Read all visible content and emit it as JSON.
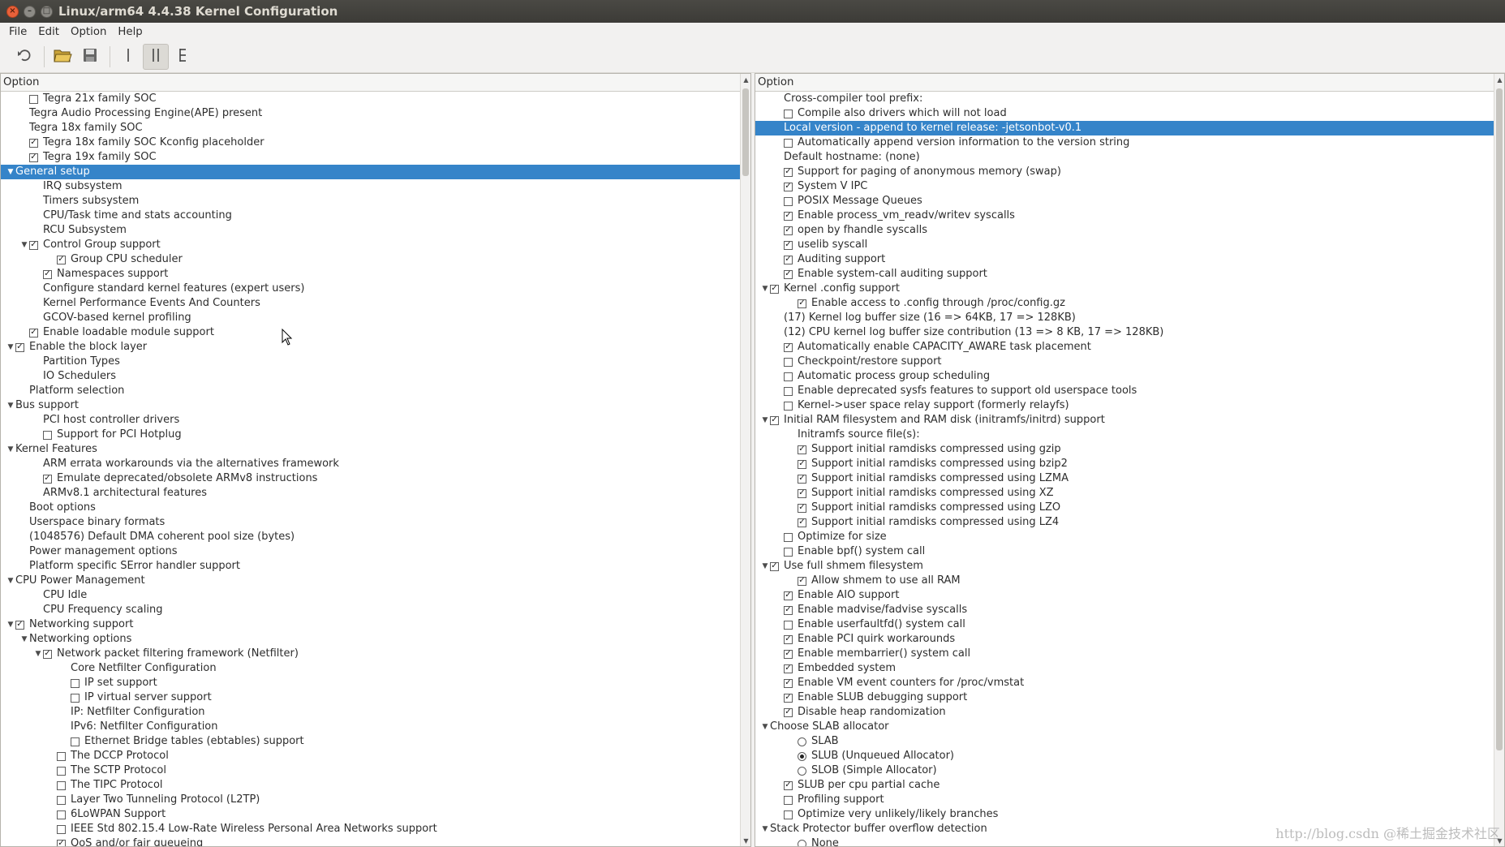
{
  "window": {
    "title": "Linux/arm64 4.4.38 Kernel Configuration"
  },
  "menubar": {
    "items": [
      {
        "label": "File"
      },
      {
        "label": "Edit"
      },
      {
        "label": "Option"
      },
      {
        "label": "Help"
      }
    ]
  },
  "toolbar": {
    "icons": [
      "undo-icon",
      "open-folder-icon",
      "save-icon",
      "single-view-icon",
      "split-view-icon",
      "full-tree-view-icon"
    ]
  },
  "left_panel": {
    "header": "Option",
    "rows": [
      {
        "indent": 1,
        "expander": "",
        "check": "off",
        "label": "Tegra 21x family SOC"
      },
      {
        "indent": 1,
        "expander": "",
        "check": "none",
        "label": "Tegra Audio Processing Engine(APE) present"
      },
      {
        "indent": 1,
        "expander": "",
        "check": "none",
        "label": "Tegra 18x family SOC"
      },
      {
        "indent": 1,
        "expander": "",
        "check": "on",
        "label": "Tegra 18x family SOC Kconfig placeholder"
      },
      {
        "indent": 1,
        "expander": "",
        "check": "on",
        "label": "Tegra 19x family SOC"
      },
      {
        "indent": 0,
        "expander": "open",
        "check": "none",
        "label": "General setup",
        "selected": true
      },
      {
        "indent": 2,
        "expander": "",
        "check": "none",
        "label": "IRQ subsystem"
      },
      {
        "indent": 2,
        "expander": "",
        "check": "none",
        "label": "Timers subsystem"
      },
      {
        "indent": 2,
        "expander": "",
        "check": "none",
        "label": "CPU/Task time and stats accounting"
      },
      {
        "indent": 2,
        "expander": "",
        "check": "none",
        "label": "RCU Subsystem"
      },
      {
        "indent": 1,
        "expander": "open",
        "check": "on",
        "label": "Control Group support"
      },
      {
        "indent": 3,
        "expander": "",
        "check": "on",
        "label": "Group CPU scheduler"
      },
      {
        "indent": 2,
        "expander": "",
        "check": "on",
        "label": "Namespaces support"
      },
      {
        "indent": 2,
        "expander": "",
        "check": "none",
        "label": "Configure standard kernel features (expert users)"
      },
      {
        "indent": 2,
        "expander": "",
        "check": "none",
        "label": "Kernel Performance Events And Counters"
      },
      {
        "indent": 2,
        "expander": "",
        "check": "none",
        "label": "GCOV-based kernel profiling"
      },
      {
        "indent": 1,
        "expander": "",
        "check": "on",
        "label": "Enable loadable module support"
      },
      {
        "indent": 0,
        "expander": "open",
        "check": "on",
        "label": "Enable the block layer"
      },
      {
        "indent": 2,
        "expander": "",
        "check": "none",
        "label": "Partition Types"
      },
      {
        "indent": 2,
        "expander": "",
        "check": "none",
        "label": "IO Schedulers"
      },
      {
        "indent": 1,
        "expander": "",
        "check": "none",
        "label": "Platform selection"
      },
      {
        "indent": 0,
        "expander": "open",
        "check": "none",
        "label": "Bus support"
      },
      {
        "indent": 2,
        "expander": "",
        "check": "none",
        "label": "PCI host controller drivers"
      },
      {
        "indent": 2,
        "expander": "",
        "check": "off",
        "label": "Support for PCI Hotplug"
      },
      {
        "indent": 0,
        "expander": "open",
        "check": "none",
        "label": "Kernel Features"
      },
      {
        "indent": 2,
        "expander": "",
        "check": "none",
        "label": "ARM errata workarounds via the alternatives framework"
      },
      {
        "indent": 2,
        "expander": "",
        "check": "on",
        "label": "Emulate deprecated/obsolete ARMv8 instructions"
      },
      {
        "indent": 2,
        "expander": "",
        "check": "none",
        "label": "ARMv8.1 architectural features"
      },
      {
        "indent": 1,
        "expander": "",
        "check": "none",
        "label": "Boot options"
      },
      {
        "indent": 1,
        "expander": "",
        "check": "none",
        "label": "Userspace binary formats"
      },
      {
        "indent": 1,
        "expander": "",
        "check": "none",
        "label": "(1048576) Default  DMA coherent pool size (bytes)"
      },
      {
        "indent": 1,
        "expander": "",
        "check": "none",
        "label": "Power management options"
      },
      {
        "indent": 1,
        "expander": "",
        "check": "none",
        "label": "Platform specific SError handler support"
      },
      {
        "indent": 0,
        "expander": "open",
        "check": "none",
        "label": "CPU Power Management"
      },
      {
        "indent": 2,
        "expander": "",
        "check": "none",
        "label": "CPU Idle"
      },
      {
        "indent": 2,
        "expander": "",
        "check": "none",
        "label": "CPU Frequency scaling"
      },
      {
        "indent": 0,
        "expander": "open",
        "check": "on",
        "label": "Networking support"
      },
      {
        "indent": 1,
        "expander": "open",
        "check": "none",
        "label": "Networking options"
      },
      {
        "indent": 2,
        "expander": "open",
        "check": "on",
        "label": "Network packet filtering framework (Netfilter)"
      },
      {
        "indent": 4,
        "expander": "",
        "check": "none",
        "label": "Core Netfilter Configuration"
      },
      {
        "indent": 4,
        "expander": "",
        "check": "off",
        "label": "IP set support"
      },
      {
        "indent": 4,
        "expander": "",
        "check": "off",
        "label": "IP virtual server support"
      },
      {
        "indent": 4,
        "expander": "",
        "check": "none",
        "label": "IP: Netfilter Configuration"
      },
      {
        "indent": 4,
        "expander": "",
        "check": "none",
        "label": "IPv6: Netfilter Configuration"
      },
      {
        "indent": 4,
        "expander": "",
        "check": "off",
        "label": "Ethernet Bridge tables (ebtables) support"
      },
      {
        "indent": 3,
        "expander": "",
        "check": "off",
        "label": "The DCCP Protocol"
      },
      {
        "indent": 3,
        "expander": "",
        "check": "off",
        "label": "The SCTP Protocol"
      },
      {
        "indent": 3,
        "expander": "",
        "check": "off",
        "label": "The TIPC Protocol"
      },
      {
        "indent": 3,
        "expander": "",
        "check": "off",
        "label": "Layer Two Tunneling Protocol (L2TP)"
      },
      {
        "indent": 3,
        "expander": "",
        "check": "off",
        "label": "6LoWPAN Support"
      },
      {
        "indent": 3,
        "expander": "",
        "check": "off",
        "label": "IEEE Std 802.15.4 Low-Rate Wireless Personal Area Networks support"
      },
      {
        "indent": 3,
        "expander": "",
        "check": "on",
        "label": "QoS and/or fair queueing"
      }
    ]
  },
  "right_panel": {
    "header": "Option",
    "rows": [
      {
        "indent": 1,
        "expander": "",
        "check": "none",
        "label": "Cross-compiler tool prefix:"
      },
      {
        "indent": 1,
        "expander": "",
        "check": "off",
        "label": "Compile also drivers which will not load"
      },
      {
        "indent": 1,
        "expander": "",
        "check": "none",
        "label": "Local version - append to kernel release: -jetsonbot-v0.1",
        "selected": true
      },
      {
        "indent": 1,
        "expander": "",
        "check": "off",
        "label": "Automatically append version information to the version string"
      },
      {
        "indent": 1,
        "expander": "",
        "check": "none",
        "label": "Default hostname: (none)"
      },
      {
        "indent": 1,
        "expander": "",
        "check": "on",
        "label": "Support for paging of anonymous memory (swap)"
      },
      {
        "indent": 1,
        "expander": "",
        "check": "on",
        "label": "System V IPC"
      },
      {
        "indent": 1,
        "expander": "",
        "check": "off",
        "label": "POSIX Message Queues"
      },
      {
        "indent": 1,
        "expander": "",
        "check": "on",
        "label": "Enable process_vm_readv/writev syscalls"
      },
      {
        "indent": 1,
        "expander": "",
        "check": "on",
        "label": "open by fhandle syscalls"
      },
      {
        "indent": 1,
        "expander": "",
        "check": "on",
        "label": "uselib syscall"
      },
      {
        "indent": 1,
        "expander": "",
        "check": "on",
        "label": "Auditing support"
      },
      {
        "indent": 1,
        "expander": "",
        "check": "on",
        "label": "Enable system-call auditing support"
      },
      {
        "indent": 0,
        "expander": "open",
        "check": "on",
        "label": "Kernel .config support"
      },
      {
        "indent": 2,
        "expander": "",
        "check": "on",
        "label": "Enable access to .config through /proc/config.gz"
      },
      {
        "indent": 1,
        "expander": "",
        "check": "none",
        "label": "(17) Kernel log buffer size (16 => 64KB, 17 => 128KB)"
      },
      {
        "indent": 1,
        "expander": "",
        "check": "none",
        "label": "(12) CPU kernel log buffer size contribution (13 => 8 KB, 17 => 128KB)"
      },
      {
        "indent": 1,
        "expander": "",
        "check": "on",
        "label": "Automatically enable CAPACITY_AWARE task placement"
      },
      {
        "indent": 1,
        "expander": "",
        "check": "off",
        "label": "Checkpoint/restore support"
      },
      {
        "indent": 1,
        "expander": "",
        "check": "off",
        "label": "Automatic process group scheduling"
      },
      {
        "indent": 1,
        "expander": "",
        "check": "off",
        "label": "Enable deprecated sysfs features to support old userspace tools"
      },
      {
        "indent": 1,
        "expander": "",
        "check": "off",
        "label": "Kernel->user space relay support (formerly relayfs)"
      },
      {
        "indent": 0,
        "expander": "open",
        "check": "on",
        "label": "Initial RAM filesystem and RAM disk (initramfs/initrd) support"
      },
      {
        "indent": 2,
        "expander": "",
        "check": "none",
        "label": "Initramfs source file(s):"
      },
      {
        "indent": 2,
        "expander": "",
        "check": "on",
        "label": "Support initial ramdisks compressed using gzip"
      },
      {
        "indent": 2,
        "expander": "",
        "check": "on",
        "label": "Support initial ramdisks compressed using bzip2"
      },
      {
        "indent": 2,
        "expander": "",
        "check": "on",
        "label": "Support initial ramdisks compressed using LZMA"
      },
      {
        "indent": 2,
        "expander": "",
        "check": "on",
        "label": "Support initial ramdisks compressed using XZ"
      },
      {
        "indent": 2,
        "expander": "",
        "check": "on",
        "label": "Support initial ramdisks compressed using LZO"
      },
      {
        "indent": 2,
        "expander": "",
        "check": "on",
        "label": "Support initial ramdisks compressed using LZ4"
      },
      {
        "indent": 1,
        "expander": "",
        "check": "off",
        "label": "Optimize for size"
      },
      {
        "indent": 1,
        "expander": "",
        "check": "off",
        "label": "Enable bpf() system call"
      },
      {
        "indent": 0,
        "expander": "open",
        "check": "on",
        "label": "Use full shmem filesystem"
      },
      {
        "indent": 2,
        "expander": "",
        "check": "on",
        "label": "Allow shmem to use all RAM"
      },
      {
        "indent": 1,
        "expander": "",
        "check": "on",
        "label": "Enable AIO support"
      },
      {
        "indent": 1,
        "expander": "",
        "check": "on",
        "label": "Enable madvise/fadvise syscalls"
      },
      {
        "indent": 1,
        "expander": "",
        "check": "off",
        "label": "Enable userfaultfd() system call"
      },
      {
        "indent": 1,
        "expander": "",
        "check": "on",
        "label": "Enable PCI quirk workarounds"
      },
      {
        "indent": 1,
        "expander": "",
        "check": "on",
        "label": "Enable membarrier() system call"
      },
      {
        "indent": 1,
        "expander": "",
        "check": "on",
        "label": "Embedded system"
      },
      {
        "indent": 1,
        "expander": "",
        "check": "on",
        "label": "Enable VM event counters for /proc/vmstat"
      },
      {
        "indent": 1,
        "expander": "",
        "check": "on",
        "label": "Enable SLUB debugging support"
      },
      {
        "indent": 1,
        "expander": "",
        "check": "on",
        "label": "Disable heap randomization"
      },
      {
        "indent": 0,
        "expander": "open",
        "check": "none",
        "label": "Choose SLAB allocator"
      },
      {
        "indent": 2,
        "expander": "",
        "check": "radio-off",
        "label": "SLAB"
      },
      {
        "indent": 2,
        "expander": "",
        "check": "radio-on",
        "label": "SLUB (Unqueued Allocator)"
      },
      {
        "indent": 2,
        "expander": "",
        "check": "radio-off",
        "label": "SLOB (Simple Allocator)"
      },
      {
        "indent": 1,
        "expander": "",
        "check": "on",
        "label": "SLUB per cpu partial cache"
      },
      {
        "indent": 1,
        "expander": "",
        "check": "off",
        "label": "Profiling support"
      },
      {
        "indent": 1,
        "expander": "",
        "check": "off",
        "label": "Optimize very unlikely/likely branches"
      },
      {
        "indent": 0,
        "expander": "open",
        "check": "none",
        "label": "Stack Protector buffer overflow detection"
      },
      {
        "indent": 2,
        "expander": "",
        "check": "radio-off",
        "label": "None"
      }
    ]
  },
  "watermark": "http://blog.csdn @稀土掘金技术社区",
  "colors": {
    "selection": "#3584c9",
    "titlebar": "#3c3b37",
    "close_button": "#e8613a"
  }
}
